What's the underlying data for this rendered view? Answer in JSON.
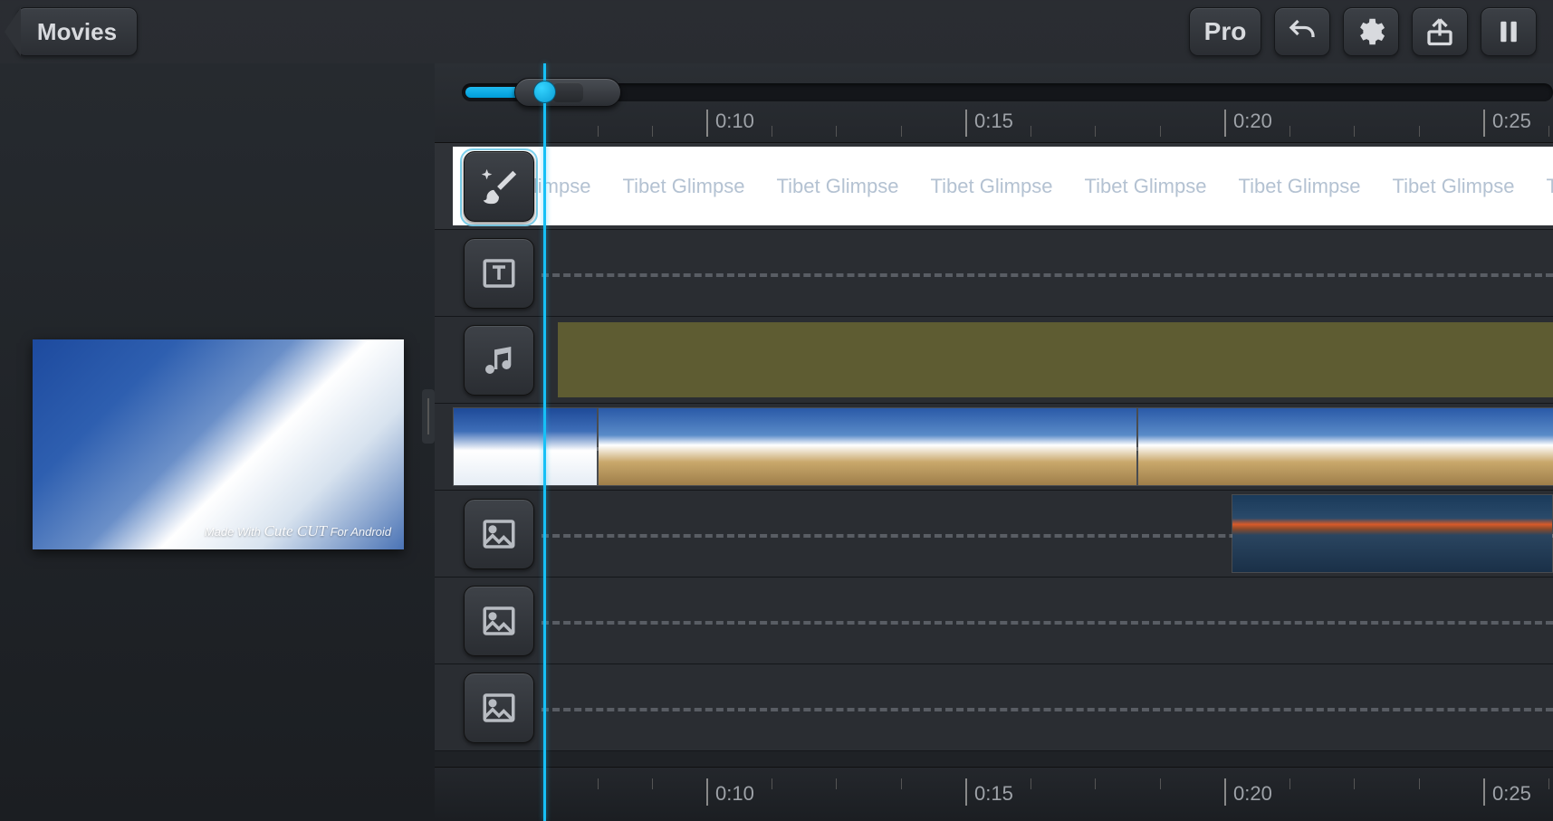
{
  "toolbar": {
    "back_label": "Movies",
    "pro_label": "Pro"
  },
  "ruler": {
    "ticks": [
      "0:10",
      "0:15",
      "0:20",
      "0:25"
    ]
  },
  "preview": {
    "watermark_prefix": "Made With",
    "watermark_brand": "Cute CUT",
    "watermark_suffix": "For Android"
  },
  "effects": {
    "title_repeat": "Tibet Glimpse"
  },
  "icons": {
    "back": "back-chevron-icon",
    "undo": "undo-icon",
    "settings": "gear-icon",
    "share": "share-icon",
    "pause": "pause-icon",
    "effects": "paintbrush-sparkle-icon",
    "text": "text-box-icon",
    "audio": "music-note-icon",
    "image": "image-icon"
  }
}
